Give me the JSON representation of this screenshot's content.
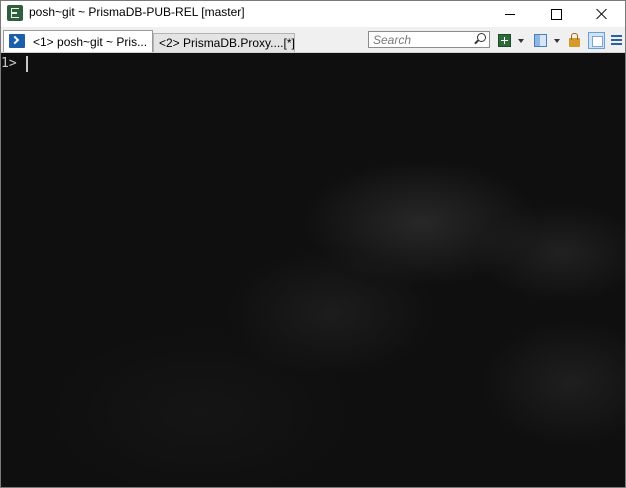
{
  "window": {
    "title": "posh~git ~ PrismaDB-PUB-REL [master]"
  },
  "tabs": [
    {
      "label": "<1> posh~git ~ Pris...",
      "active": true,
      "icon": "powershell-icon"
    },
    {
      "label": "<2> PrismaDB.Proxy....[*]",
      "active": false
    }
  ],
  "toolbar": {
    "search_placeholder": "Search",
    "icons": [
      "new-console-icon",
      "split-view-icon",
      "lock-icon",
      "panel-icon",
      "menu-icon"
    ]
  },
  "console": {
    "prompt": "1>"
  },
  "colors": {
    "console_bg": "#0f0f0f",
    "console_text": "#c8c8c8",
    "accent": "#1b5fa8"
  }
}
